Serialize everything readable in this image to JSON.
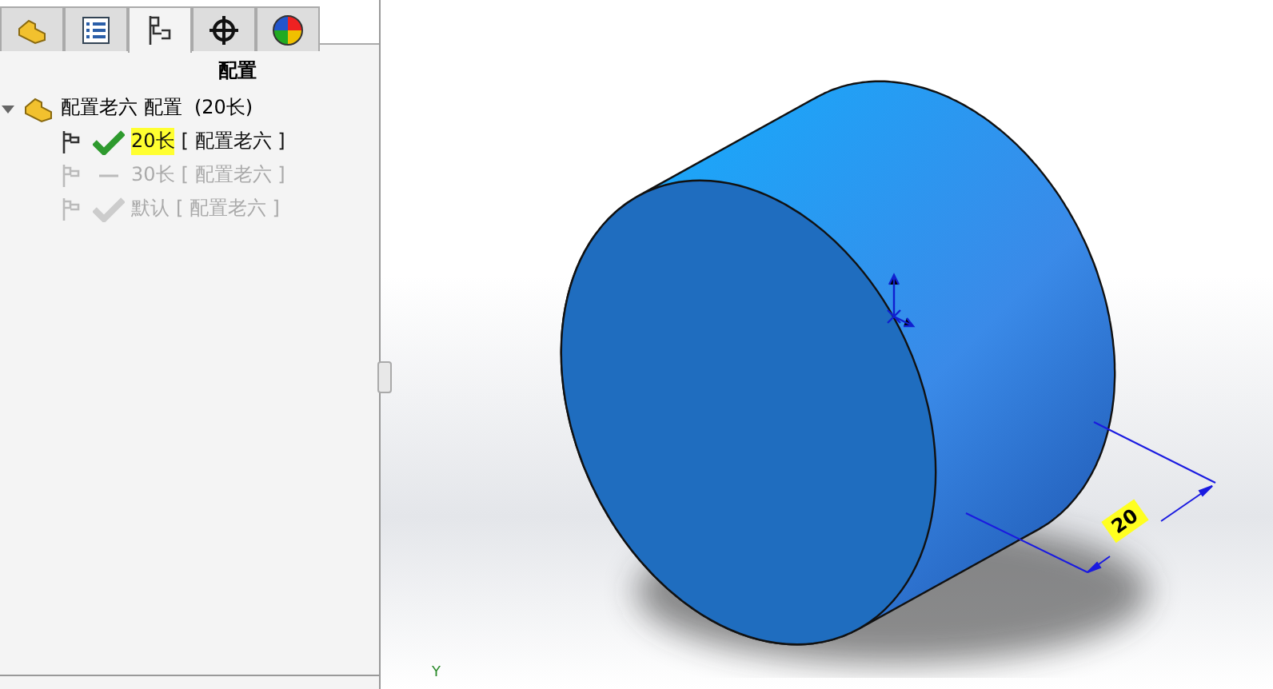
{
  "tabs": [
    {
      "kind": "part",
      "selected": false
    },
    {
      "kind": "property",
      "selected": false
    },
    {
      "kind": "config",
      "selected": true
    },
    {
      "kind": "target",
      "selected": false
    },
    {
      "kind": "appearance",
      "selected": false
    }
  ],
  "panel": {
    "title": "配置"
  },
  "tree": {
    "label": "配置老六 配置  (20长)",
    "expanded": true,
    "children": [
      {
        "name": "20长",
        "config": "[ 配置老六 ]",
        "active": true,
        "kind": "check"
      },
      {
        "name": "30长",
        "config": "[ 配置老六 ]",
        "active": false,
        "kind": "dash"
      },
      {
        "name": "默认",
        "config": "[ 配置老六 ]",
        "active": false,
        "kind": "check"
      }
    ]
  },
  "viewport": {
    "dimension": "20",
    "axis_label": "Y"
  }
}
